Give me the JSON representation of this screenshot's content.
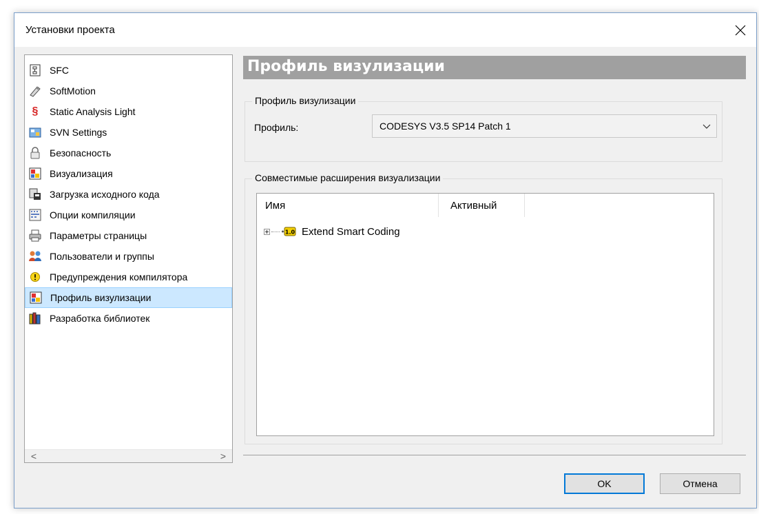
{
  "window": {
    "title": "Установки проекта"
  },
  "tree": {
    "items": [
      {
        "label": "SFC",
        "icon": "sfc-icon",
        "selected": false
      },
      {
        "label": "SoftMotion",
        "icon": "softmotion-icon",
        "selected": false
      },
      {
        "label": "Static Analysis Light",
        "icon": "paragraph-icon",
        "selected": false
      },
      {
        "label": "SVN Settings",
        "icon": "svn-icon",
        "selected": false
      },
      {
        "label": "Безопасность",
        "icon": "lock-icon",
        "selected": false
      },
      {
        "label": "Визуализация",
        "icon": "visualization-icon",
        "selected": false
      },
      {
        "label": "Загрузка исходного кода",
        "icon": "source-download-icon",
        "selected": false
      },
      {
        "label": "Опции компиляции",
        "icon": "compile-options-icon",
        "selected": false
      },
      {
        "label": "Параметры страницы",
        "icon": "printer-icon",
        "selected": false
      },
      {
        "label": "Пользователи и группы",
        "icon": "users-icon",
        "selected": false
      },
      {
        "label": "Предупреждения компилятора",
        "icon": "warning-icon",
        "selected": false
      },
      {
        "label": "Профиль визулизации",
        "icon": "visualization-profile-icon",
        "selected": true
      },
      {
        "label": "Разработка библиотек",
        "icon": "library-icon",
        "selected": false
      }
    ],
    "scroll_left": "<",
    "scroll_right": ">"
  },
  "pane": {
    "header": "Профиль визулизации",
    "profile_group": {
      "legend": "Профиль визулизации",
      "label": "Профиль:",
      "value": "CODESYS V3.5 SP14 Patch 1"
    },
    "extensions_group": {
      "legend": "Совместимые расширения визуализации",
      "columns": [
        "Имя",
        "Активный"
      ],
      "rows": [
        {
          "name": "Extend Smart Coding",
          "badge": "1.0"
        }
      ]
    }
  },
  "buttons": {
    "ok": "OK",
    "cancel": "Отмена"
  },
  "colors": {
    "header_bg": "#a0a0a0",
    "selection_bg": "#cce8ff",
    "dialog_bg": "#f0f0f0",
    "default_button_border": "#0078d7"
  }
}
